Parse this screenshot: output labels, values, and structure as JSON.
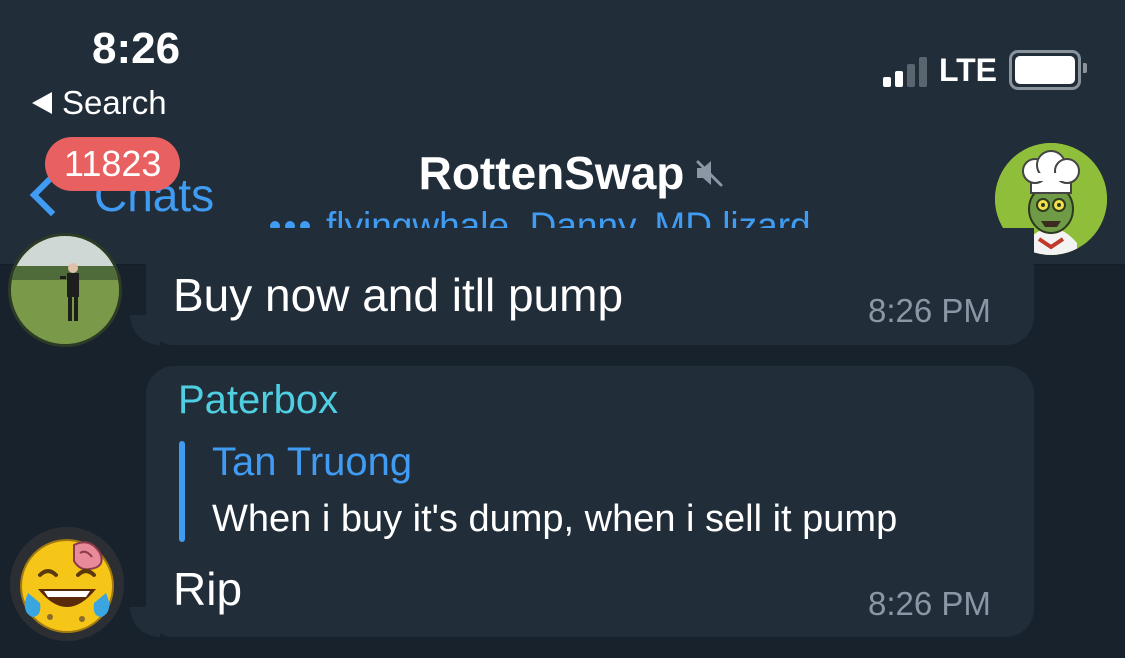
{
  "status_bar": {
    "time": "8:26",
    "back_app_label": "Search",
    "network": "LTE"
  },
  "nav": {
    "back_label": "Chats",
    "unread_badge": "11823"
  },
  "chat": {
    "title": "RottenSwap",
    "subtitle": "flyingwhale, Danny, MD lizard",
    "muted": true
  },
  "messages": [
    {
      "text": "Buy now and itll pump",
      "time": "8:26 PM"
    },
    {
      "sender": "Paterbox",
      "reply_to": {
        "name": "Tan Truong",
        "text": "When i buy it's dump, when i sell it pump"
      },
      "text": "Rip",
      "time": "8:26 PM"
    }
  ],
  "colors": {
    "accent": "#3f9cf2",
    "sender_name": "#4fd0e2",
    "badge": "#e8605f",
    "bubble": "#222d3a",
    "background": "#18222d"
  },
  "icons": {
    "back": "chevron-left-icon",
    "muted": "speaker-muted-icon",
    "typing": "typing-dots-icon"
  }
}
